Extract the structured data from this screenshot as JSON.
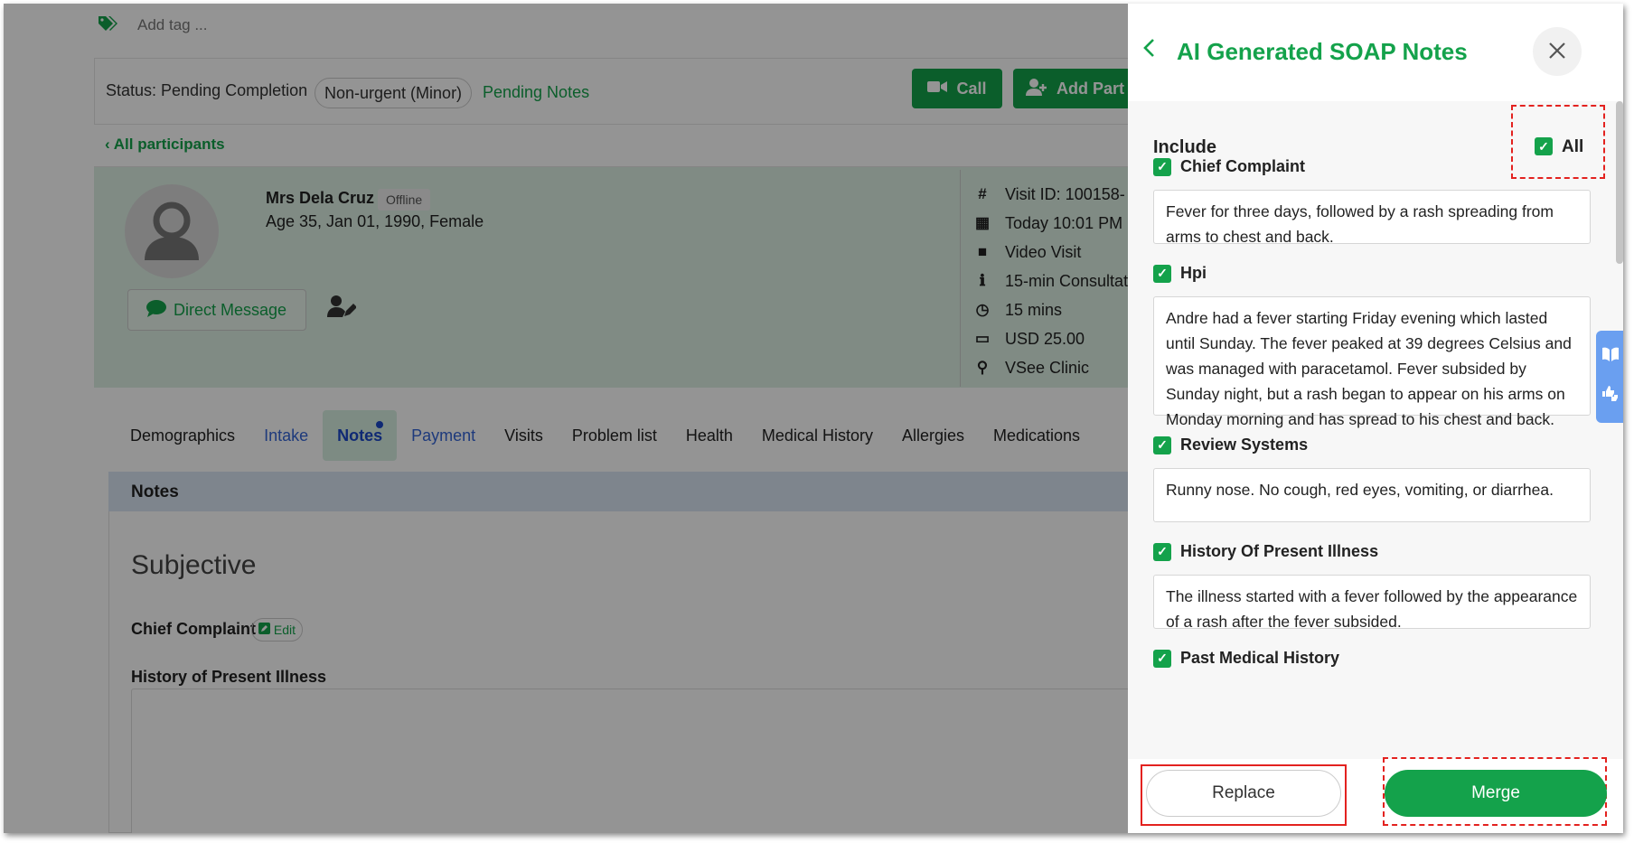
{
  "tags": {
    "placeholder": "Add tag ..."
  },
  "status": {
    "text": "Status: Pending Completion",
    "urgency": "Non-urgent (Minor)",
    "pending_link": "Pending Notes",
    "call_label": "Call",
    "add_participant_label": "Add Part"
  },
  "nav": {
    "all_participants": "All participants"
  },
  "patient": {
    "name": "Mrs Dela Cruz",
    "presence": "Offline",
    "details": "Age 35, Jan 01, 1990, Female",
    "direct_message": "Direct Message"
  },
  "visit": {
    "items": [
      {
        "icon": "hash-icon",
        "text": "Visit ID: 100158-"
      },
      {
        "icon": "calendar-icon",
        "text": "Today 10:01 PM"
      },
      {
        "icon": "video-icon",
        "text": "Video Visit"
      },
      {
        "icon": "info-icon",
        "text": "15-min Consultat"
      },
      {
        "icon": "clock-icon",
        "text": "15 mins"
      },
      {
        "icon": "credit-card-icon",
        "text": "USD 25.00"
      },
      {
        "icon": "map-pin-icon",
        "text": "VSee Clinic"
      }
    ]
  },
  "tabs": [
    {
      "label": "Demographics"
    },
    {
      "label": "Intake"
    },
    {
      "label": "Notes"
    },
    {
      "label": "Payment"
    },
    {
      "label": "Visits"
    },
    {
      "label": "Problem list"
    },
    {
      "label": "Health"
    },
    {
      "label": "Medical History"
    },
    {
      "label": "Allergies"
    },
    {
      "label": "Medications"
    }
  ],
  "notes": {
    "header": "Notes",
    "section_title": "Subjective",
    "chief_complaint_label": "Chief Complaint",
    "edit_label": "Edit",
    "hpi_label": "History of Present Illness"
  },
  "panel": {
    "title": "AI Generated SOAP Notes",
    "include_label": "Include",
    "all_label": "All",
    "sections": [
      {
        "label": "Chief Complaint",
        "checked": true,
        "text": "Fever for three days, followed by a rash spreading from arms to chest and back."
      },
      {
        "label": "Hpi",
        "checked": true,
        "text": "Andre had a fever starting Friday evening which lasted until Sunday. The fever peaked at 39 degrees Celsius and was managed with paracetamol. Fever subsided by Sunday night, but a rash began to appear on his arms on Monday morning and has spread to his chest and back."
      },
      {
        "label": "Review Systems",
        "checked": true,
        "text": "Runny nose. No cough, red eyes, vomiting, or diarrhea."
      },
      {
        "label": "History Of Present Illness",
        "checked": true,
        "text": "The illness started with a fever followed by the appearance of a rash after the fever subsided."
      },
      {
        "label": "Past Medical History",
        "checked": true,
        "text": ""
      }
    ],
    "replace_label": "Replace",
    "merge_label": "Merge"
  },
  "colors": {
    "brand_green": "#14a24b",
    "link_blue": "#3565d6",
    "highlight_red": "#e3221f"
  }
}
